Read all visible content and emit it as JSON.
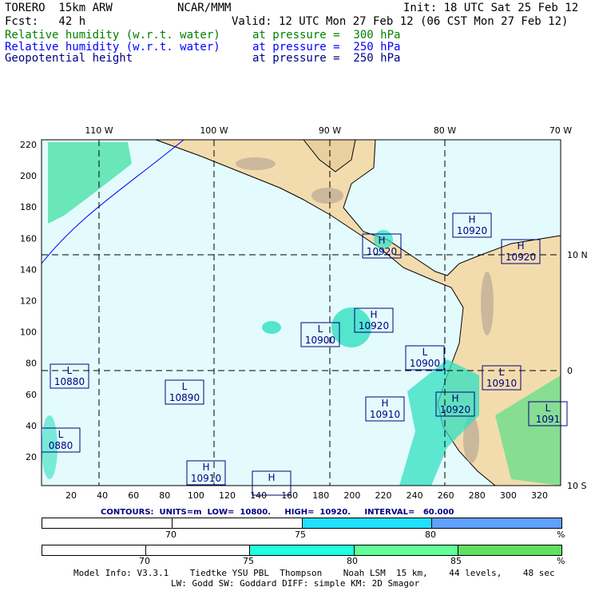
{
  "header": {
    "model": "TORERO  15km ARW",
    "org": "NCAR/MMM",
    "init": "Init: 18 UTC Sat 25 Feb 12",
    "fcst": "Fcst:   42 h",
    "valid": "Valid: 12 UTC Mon 27 Feb 12 (06 CST Mon 27 Feb 12)",
    "fields": [
      {
        "name": "Relative humidity (w.r.t. water)",
        "level": "at pressure =  300 hPa"
      },
      {
        "name": "Relative humidity (w.r.t. water)",
        "level": "at pressure =  250 hPa"
      },
      {
        "name": "Geopotential height",
        "level": "at pressure =  250 hPa"
      }
    ]
  },
  "axes": {
    "top": [
      "110 W",
      "100 W",
      "90 W",
      "80 W",
      "70 W"
    ],
    "right": [
      "10 N",
      "0",
      "10 S"
    ],
    "left": [
      "20",
      "40",
      "60",
      "80",
      "100",
      "120",
      "140",
      "160",
      "180",
      "200",
      "220"
    ],
    "bottom": [
      "20",
      "40",
      "60",
      "80",
      "100",
      "120",
      "140",
      "160",
      "180",
      "200",
      "220",
      "240",
      "260",
      "280",
      "300",
      "320"
    ]
  },
  "centers": [
    {
      "type": "H",
      "value": "10920"
    },
    {
      "type": "H",
      "value": "10920"
    },
    {
      "type": "H",
      "value": "10920"
    },
    {
      "type": "H",
      "value": "10920"
    },
    {
      "type": "L",
      "value": "10900"
    },
    {
      "type": "L",
      "value": "10900"
    },
    {
      "type": "L",
      "value": "10880"
    },
    {
      "type": "L",
      "value": "10890"
    },
    {
      "type": "L",
      "value": "10910"
    },
    {
      "type": "H",
      "value": "10920"
    },
    {
      "type": "H",
      "value": "10910"
    },
    {
      "type": "L",
      "value": "0880"
    },
    {
      "type": "H",
      "value": "10910"
    },
    {
      "type": "H",
      "value": ""
    },
    {
      "type": "L",
      "value": "1091"
    }
  ],
  "contours": "CONTOURS:  UNITS=m  LOW=  10800.     HIGH=  10920.     INTERVAL=   60.000",
  "legend1": {
    "labels": [
      "70",
      "75",
      "80",
      "%"
    ],
    "colors": [
      "#ffffff",
      "#ffffff",
      "#20e0ff",
      "#60a0ff"
    ]
  },
  "legend2": {
    "labels": [
      "70",
      "75",
      "80",
      "85",
      "%"
    ],
    "colors": [
      "#ffffff",
      "#ffffff",
      "#20ffe0",
      "#60ff98",
      "#60e060"
    ]
  },
  "footer": [
    "Model Info: V3.3.1    Tiedtke YSU PBL  Thompson    Noah LSM  15 km,    44 levels,    48 sec",
    "LW: Godd SW: Goddard DIFF: simple KM: 2D Smagor"
  ]
}
